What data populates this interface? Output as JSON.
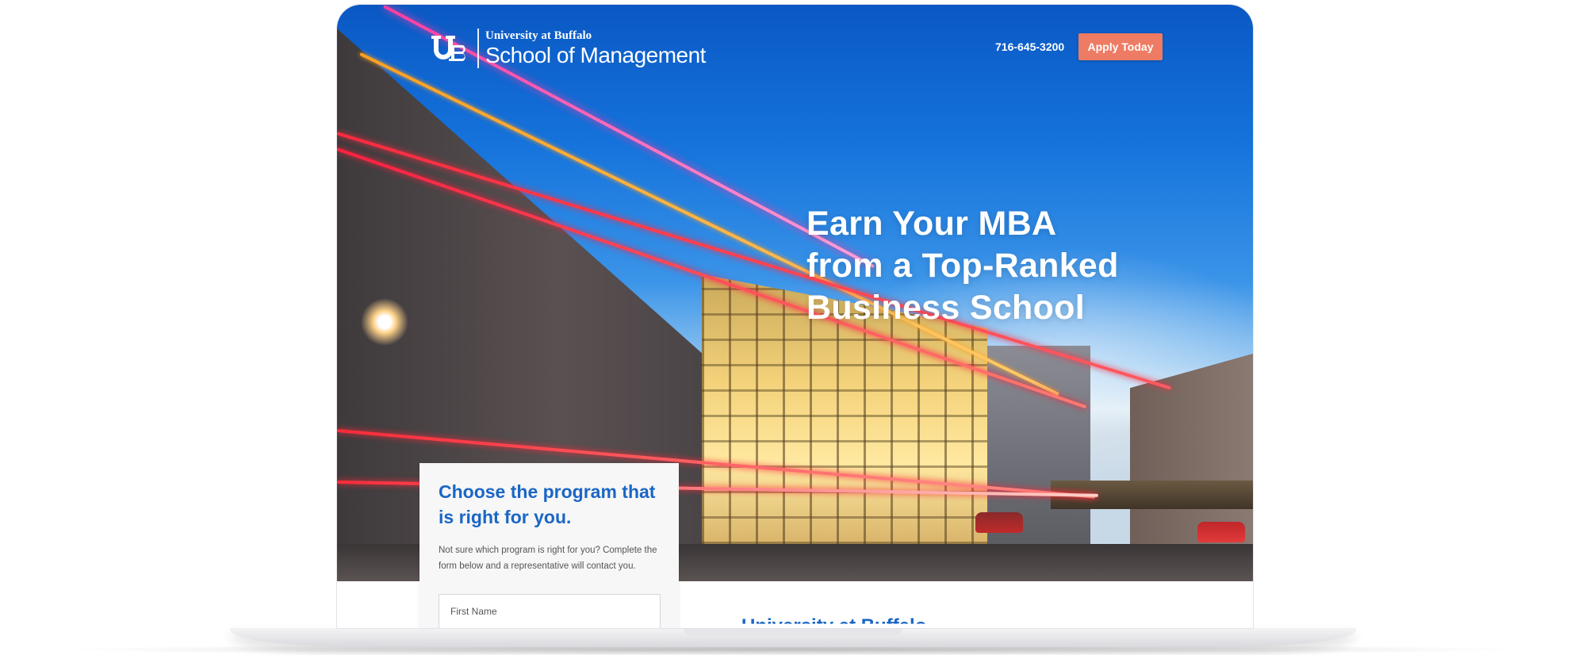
{
  "header": {
    "logo_mark": "UB",
    "university": "University at Buffalo",
    "school": "School of Management",
    "phone": "716-645-3200",
    "apply_label": "Apply Today"
  },
  "hero": {
    "headline_lines": [
      "Earn Your MBA",
      "from a Top-Ranked",
      "Business School"
    ]
  },
  "form": {
    "title": "Choose the program that is right for you.",
    "description": "Not sure which program is right for you? Complete the form below and a representative will contact you.",
    "first_name_placeholder": "First Name"
  },
  "below_section": {
    "heading_partial": "University at Buffalo"
  },
  "colors": {
    "accent_blue": "#1a66c5",
    "apply_orange": "#ee7b63",
    "sky_blue": "#1674dc"
  }
}
